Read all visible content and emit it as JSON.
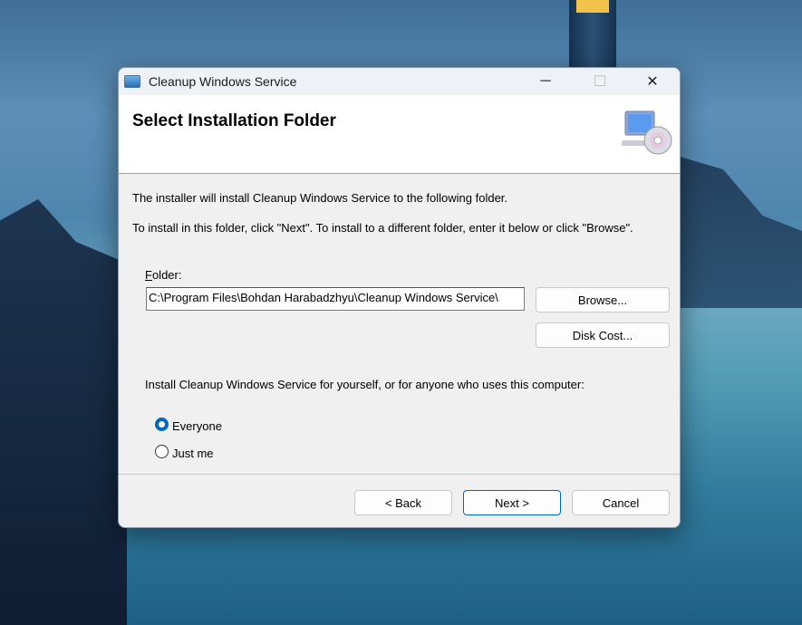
{
  "window": {
    "title": "Cleanup Windows Service",
    "minimize": "─",
    "maximize": "☐",
    "close": "✕"
  },
  "header": {
    "title": "Select Installation Folder"
  },
  "body": {
    "intro": "The installer will install Cleanup Windows Service to the following folder.",
    "instructions": "To install in this folder, click \"Next\". To install to a different folder, enter it below or click \"Browse\".",
    "folder_label_accel": "F",
    "folder_label_rest": "older:",
    "folder_value": "C:\\Program Files\\Bohdan Harabadzhyu\\Cleanup Windows Service\\",
    "browse": "Browse...",
    "disk_cost": "Disk Cost...",
    "scope_prompt": "Install Cleanup Windows Service for yourself, or for anyone who uses this computer:",
    "options": [
      {
        "label": "Everyone",
        "selected": true
      },
      {
        "label": "Just me",
        "selected": false
      }
    ]
  },
  "footer": {
    "back": "< Back",
    "next": "Next >",
    "cancel": "Cancel"
  },
  "colors": {
    "accent": "#0067c0"
  }
}
